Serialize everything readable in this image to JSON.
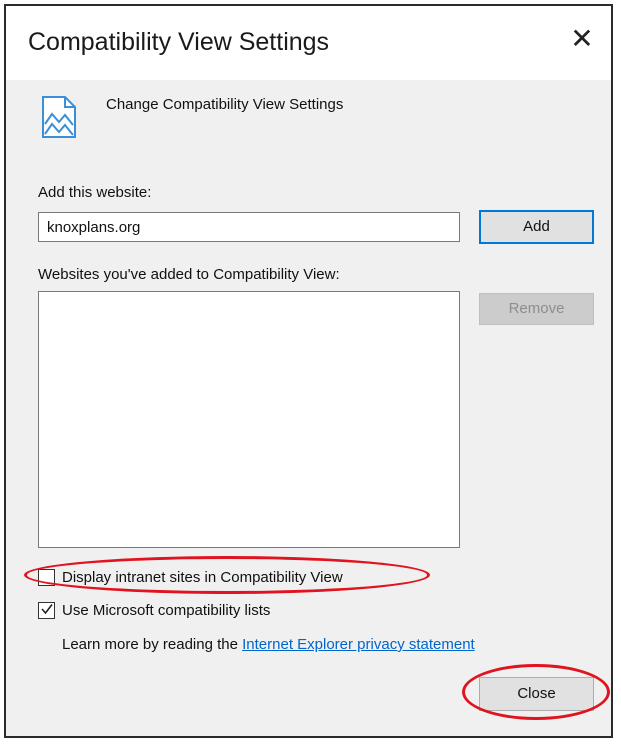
{
  "dialog": {
    "title": "Compatibility View Settings",
    "close_glyph": "✕",
    "header_icon": "compatibility-view-icon",
    "header_text": "Change Compatibility View Settings"
  },
  "add_section": {
    "label": "Add this website:",
    "input_value": "knoxplans.org",
    "add_button": "Add"
  },
  "list_section": {
    "label": "Websites you've added to Compatibility View:",
    "items": [],
    "remove_button": "Remove"
  },
  "options": {
    "intranet": {
      "label": "Display intranet sites in Compatibility View",
      "checked": false
    },
    "ms_lists": {
      "label": "Use Microsoft compatibility lists",
      "checked": true
    }
  },
  "privacy": {
    "prefix": "Learn more by reading the ",
    "link": "Internet Explorer privacy statement"
  },
  "footer": {
    "close_button": "Close"
  },
  "colors": {
    "accent": "#0078d7",
    "highlight": "#e0141e",
    "link": "#0066cc"
  }
}
